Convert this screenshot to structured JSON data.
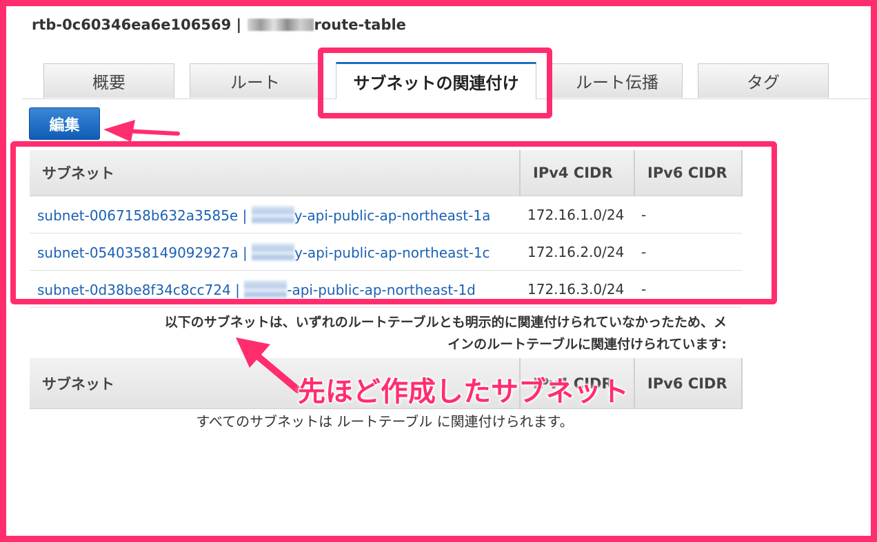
{
  "header": {
    "rt_id": "rtb-0c60346ea6e106569 |",
    "rt_suffix": "route-table"
  },
  "tabs": [
    {
      "label": "概要"
    },
    {
      "label": "ルート"
    },
    {
      "label": "サブネットの関連付け",
      "active": true
    },
    {
      "label": "ルート伝播"
    },
    {
      "label": "タグ"
    }
  ],
  "edit_button": "編集",
  "associated": {
    "columns": [
      "サブネット",
      "IPv4 CIDR",
      "IPv6 CIDR"
    ],
    "rows": [
      {
        "subnet_prefix": "subnet-0067158b632a3585e |",
        "subnet_suffix": "y-api-public-ap-northeast-1a",
        "ipv4": "172.16.1.0/24",
        "ipv6": "-"
      },
      {
        "subnet_prefix": "subnet-0540358149092927a |",
        "subnet_suffix": "y-api-public-ap-northeast-1c",
        "ipv4": "172.16.2.0/24",
        "ipv6": "-"
      },
      {
        "subnet_prefix": "subnet-0d38be8f34c8cc724 |",
        "subnet_suffix": "-api-public-ap-northeast-1d",
        "ipv4": "172.16.3.0/24",
        "ipv6": "-"
      }
    ]
  },
  "note": {
    "line1": "以下のサブネットは、いずれのルートテーブルとも明示的に関連付けられていなかったため、メ",
    "line2": "インのルートテーブルに関連付けられています:"
  },
  "main_assoc": {
    "columns": [
      "サブネット",
      "IPv4 CIDR",
      "IPv6 CIDR"
    ],
    "empty_text": "すべてのサブネットは ルートテーブル に関連付けられます。"
  },
  "annotation": {
    "callout": "先ほど作成したサブネット",
    "color": "#ff2d6e"
  }
}
